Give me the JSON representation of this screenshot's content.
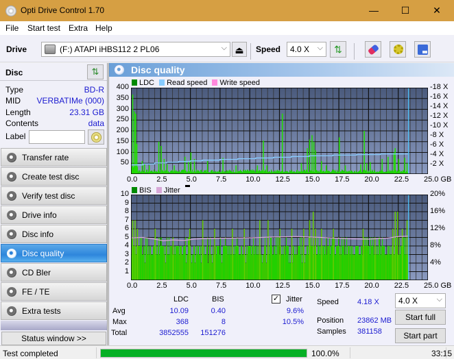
{
  "window": {
    "title": "Opti Drive Control 1.70",
    "minimize": "—",
    "maximize": "☐",
    "close": "✕"
  },
  "menu": [
    "File",
    "Start test",
    "Extra",
    "Help"
  ],
  "toolbar": {
    "drive_label": "Drive",
    "drive_value": "(F:)  ATAPI iHBS112  2 PL06",
    "eject_icon": "⏏",
    "speed_label": "Speed",
    "speed_value": "4.0 X",
    "refresh_icon": "⇅",
    "erase_icon": "eraser",
    "settings_icon": "gears",
    "save_icon": "floppy"
  },
  "disc": {
    "header": "Disc",
    "fields": [
      {
        "key": "Type",
        "value": "BD-R"
      },
      {
        "key": "MID",
        "value": "VERBATIMe (000)"
      },
      {
        "key": "Length",
        "value": "23.31 GB"
      },
      {
        "key": "Contents",
        "value": "data"
      }
    ],
    "label_key": "Label",
    "label_value": ""
  },
  "nav": [
    {
      "label": "Transfer rate",
      "active": false
    },
    {
      "label": "Create test disc",
      "active": false
    },
    {
      "label": "Verify test disc",
      "active": false
    },
    {
      "label": "Drive info",
      "active": false
    },
    {
      "label": "Disc info",
      "active": false
    },
    {
      "label": "Disc quality",
      "active": true
    },
    {
      "label": "CD Bler",
      "active": false
    },
    {
      "label": "FE / TE",
      "active": false
    },
    {
      "label": "Extra tests",
      "active": false
    }
  ],
  "status_window_button": "Status window >>",
  "panel": {
    "title": "Disc quality"
  },
  "colors": {
    "ldc": "#00a000",
    "bis": "#00a000",
    "read_speed": "#88ccff",
    "write_speed": "#ff88dd",
    "jitter": "#d8a8d8",
    "bar_green": "#22cc00",
    "plot_bg_top": "#4a5a7c",
    "plot_bg_bottom": "#8a9ac0",
    "accent_blue": "#1a1ad0",
    "progress": "#06b025"
  },
  "chart_data": [
    {
      "type": "bar",
      "title": "LDC / Read speed",
      "legend": [
        "LDC",
        "Read speed",
        "Write speed"
      ],
      "legend_placement": "top-left",
      "xlabel": "GB",
      "xlim": [
        0,
        25
      ],
      "x_ticks": [
        "0.0",
        "2.5",
        "5.0",
        "7.5",
        "10.0",
        "12.5",
        "15.0",
        "17.5",
        "20.0",
        "22.5",
        "25.0 GB"
      ],
      "ylim": [
        0,
        400
      ],
      "y_ticks": [
        "50",
        "100",
        "150",
        "200",
        "250",
        "300",
        "350",
        "400"
      ],
      "y2lim": [
        0,
        18
      ],
      "y2_ticks": [
        "2 X",
        "4 X",
        "6 X",
        "8 X",
        "10 X",
        "12 X",
        "14 X",
        "16 X",
        "18 X"
      ],
      "grid": true,
      "disc_end_gb": 23.31,
      "ldc_baseline": 15,
      "ldc_peaks": [
        {
          "x": 0.1,
          "y": 368
        },
        {
          "x": 0.25,
          "y": 290
        },
        {
          "x": 0.35,
          "y": 280
        },
        {
          "x": 0.45,
          "y": 140
        },
        {
          "x": 0.9,
          "y": 60
        },
        {
          "x": 1.1,
          "y": 45
        },
        {
          "x": 1.5,
          "y": 40
        },
        {
          "x": 2.3,
          "y": 150
        },
        {
          "x": 2.5,
          "y": 130
        },
        {
          "x": 2.75,
          "y": 70
        },
        {
          "x": 3.0,
          "y": 45
        },
        {
          "x": 3.6,
          "y": 40
        },
        {
          "x": 4.5,
          "y": 80
        },
        {
          "x": 4.8,
          "y": 60
        },
        {
          "x": 5.0,
          "y": 100
        },
        {
          "x": 5.3,
          "y": 70
        },
        {
          "x": 6.4,
          "y": 60
        },
        {
          "x": 7.7,
          "y": 75
        },
        {
          "x": 8.8,
          "y": 40
        },
        {
          "x": 10.6,
          "y": 40
        },
        {
          "x": 11.1,
          "y": 155
        },
        {
          "x": 11.4,
          "y": 40
        },
        {
          "x": 12.7,
          "y": 280
        },
        {
          "x": 14.3,
          "y": 50
        },
        {
          "x": 14.8,
          "y": 120
        },
        {
          "x": 15.0,
          "y": 160
        },
        {
          "x": 15.2,
          "y": 180
        },
        {
          "x": 15.35,
          "y": 150
        },
        {
          "x": 15.5,
          "y": 110
        },
        {
          "x": 16.0,
          "y": 60
        },
        {
          "x": 16.4,
          "y": 40
        },
        {
          "x": 17.5,
          "y": 170
        },
        {
          "x": 18.0,
          "y": 40
        },
        {
          "x": 19.3,
          "y": 45
        },
        {
          "x": 19.6,
          "y": 200
        },
        {
          "x": 19.8,
          "y": 50
        },
        {
          "x": 20.1,
          "y": 55
        },
        {
          "x": 21.1,
          "y": 70
        },
        {
          "x": 21.6,
          "y": 80
        },
        {
          "x": 22.1,
          "y": 100
        },
        {
          "x": 22.2,
          "y": 120
        },
        {
          "x": 22.5,
          "y": 70
        },
        {
          "x": 23.0,
          "y": 75
        },
        {
          "x": 23.2,
          "y": 50
        }
      ],
      "read_speed_steps": [
        {
          "x0": 0.0,
          "x1": 1.0,
          "speed": 1.9
        },
        {
          "x0": 1.0,
          "x1": 2.0,
          "speed": 2.1
        },
        {
          "x0": 2.0,
          "x1": 3.0,
          "speed": 2.3
        },
        {
          "x0": 3.0,
          "x1": 4.0,
          "speed": 2.45
        },
        {
          "x0": 4.0,
          "x1": 5.0,
          "speed": 2.6
        },
        {
          "x0": 5.0,
          "x1": 6.0,
          "speed": 2.75
        },
        {
          "x0": 6.0,
          "x1": 7.5,
          "speed": 2.9
        },
        {
          "x0": 7.5,
          "x1": 9.0,
          "speed": 3.05
        },
        {
          "x0": 9.0,
          "x1": 10.5,
          "speed": 3.2
        },
        {
          "x0": 10.5,
          "x1": 12.0,
          "speed": 3.35
        },
        {
          "x0": 12.0,
          "x1": 13.5,
          "speed": 3.5
        },
        {
          "x0": 13.5,
          "x1": 15.0,
          "speed": 3.65
        },
        {
          "x0": 15.0,
          "x1": 17.0,
          "speed": 3.8
        },
        {
          "x0": 17.0,
          "x1": 19.0,
          "speed": 3.95
        },
        {
          "x0": 19.0,
          "x1": 21.0,
          "speed": 4.05
        },
        {
          "x0": 21.0,
          "x1": 23.31,
          "speed": 4.18
        }
      ]
    },
    {
      "type": "bar",
      "title": "BIS / Jitter",
      "legend": [
        "BIS",
        "Jitter"
      ],
      "legend_placement": "top-left",
      "xlabel": "GB",
      "xlim": [
        0,
        25
      ],
      "x_ticks": [
        "0.0",
        "2.5",
        "5.0",
        "7.5",
        "10.0",
        "12.5",
        "15.0",
        "17.5",
        "20.0",
        "22.5",
        "25.0 GB"
      ],
      "ylim": [
        0,
        10
      ],
      "y_ticks": [
        "1",
        "2",
        "3",
        "4",
        "5",
        "6",
        "7",
        "8",
        "9",
        "10"
      ],
      "y2lim": [
        0,
        20
      ],
      "y2_ticks": [
        "4%",
        "8%",
        "12%",
        "16%",
        "20%"
      ],
      "grid": true,
      "disc_end_gb": 23.31,
      "bis_typical_max": 4,
      "bis_peaks": [
        {
          "x": 0.1,
          "y": 7
        },
        {
          "x": 0.3,
          "y": 7
        },
        {
          "x": 0.5,
          "y": 6
        },
        {
          "x": 2.0,
          "y": 6
        },
        {
          "x": 3.5,
          "y": 5
        },
        {
          "x": 4.9,
          "y": 6
        },
        {
          "x": 6.0,
          "y": 7
        },
        {
          "x": 7.0,
          "y": 6
        },
        {
          "x": 8.5,
          "y": 6
        },
        {
          "x": 9.5,
          "y": 6
        },
        {
          "x": 10.8,
          "y": 7
        },
        {
          "x": 11.5,
          "y": 7
        },
        {
          "x": 12.5,
          "y": 6
        },
        {
          "x": 13.5,
          "y": 6
        },
        {
          "x": 14.5,
          "y": 6
        },
        {
          "x": 15.0,
          "y": 7
        },
        {
          "x": 15.3,
          "y": 8
        },
        {
          "x": 15.5,
          "y": 6
        },
        {
          "x": 16.0,
          "y": 6
        },
        {
          "x": 17.0,
          "y": 6
        },
        {
          "x": 19.5,
          "y": 6
        },
        {
          "x": 20.5,
          "y": 5
        },
        {
          "x": 22.0,
          "y": 6
        },
        {
          "x": 22.2,
          "y": 8
        },
        {
          "x": 22.4,
          "y": 8
        },
        {
          "x": 22.8,
          "y": 6
        },
        {
          "x": 23.2,
          "y": 7
        }
      ],
      "jitter_points": [
        {
          "x": 0.0,
          "y": 9.9
        },
        {
          "x": 1.0,
          "y": 10.0
        },
        {
          "x": 2.0,
          "y": 9.6
        },
        {
          "x": 2.7,
          "y": 9.2
        },
        {
          "x": 3.5,
          "y": 9.4
        },
        {
          "x": 4.5,
          "y": 9.3
        },
        {
          "x": 5.3,
          "y": 9.6
        },
        {
          "x": 6.0,
          "y": 9.7
        },
        {
          "x": 8.0,
          "y": 9.8
        },
        {
          "x": 10.0,
          "y": 9.9
        },
        {
          "x": 12.0,
          "y": 10.1
        },
        {
          "x": 14.0,
          "y": 10.2
        },
        {
          "x": 16.0,
          "y": 10.0
        },
        {
          "x": 18.0,
          "y": 9.7
        },
        {
          "x": 20.0,
          "y": 9.6
        },
        {
          "x": 21.5,
          "y": 9.8
        },
        {
          "x": 22.5,
          "y": 10.2
        },
        {
          "x": 23.31,
          "y": 10.3
        }
      ]
    }
  ],
  "stats": {
    "col_ldc": "LDC",
    "col_bis": "BIS",
    "jitter_label": "Jitter",
    "jitter_checked": true,
    "rows": [
      {
        "label": "Avg",
        "ldc": "10.09",
        "bis": "0.40",
        "jitter": "9.6%"
      },
      {
        "label": "Max",
        "ldc": "368",
        "bis": "8",
        "jitter": "10.5%"
      },
      {
        "label": "Total",
        "ldc": "3852555",
        "bis": "151276",
        "jitter": ""
      }
    ],
    "speed_label": "Speed",
    "speed_value": "4.18 X",
    "position_label": "Position",
    "position_value": "23862 MB",
    "samples_label": "Samples",
    "samples_value": "381158",
    "speed_select": "4.0 X",
    "start_full": "Start full",
    "start_part": "Start part"
  },
  "statusbar": {
    "text": "Test completed",
    "progress_percent": 100,
    "progress_text": "100.0%",
    "elapsed": "33:15"
  }
}
